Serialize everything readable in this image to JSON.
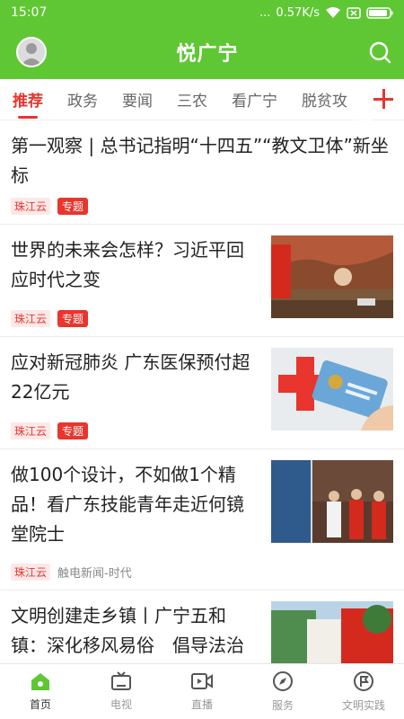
{
  "status": {
    "time": "15:07",
    "dots": "...",
    "speed": "0.57K/s"
  },
  "app": {
    "title": "悦广宁"
  },
  "tabs": [
    "推荐",
    "政务",
    "要闻",
    "三农",
    "看广宁",
    "脱贫攻"
  ],
  "articles": [
    {
      "title": "第一观察 | 总书记指明“十四五”“教文卫体”新坐标",
      "source": "珠江云",
      "tag": "专题"
    },
    {
      "title": "世界的未来会怎样？习近平回应时代之变",
      "source": "珠江云",
      "tag": "专题"
    },
    {
      "title": "应对新冠肺炎 广东医保预付超22亿元",
      "source": "珠江云",
      "tag": "专题"
    },
    {
      "title": "做100个设计，不如做1个精品！看广东技能青年走近何镜堂院士",
      "source": "珠江云",
      "meta": "触电新闻-时代"
    },
    {
      "title": "文明创建走乡镇丨广宁五和镇：深化移风易俗　倡导法治"
    }
  ],
  "nav": [
    {
      "label": "首页",
      "icon": "home-icon",
      "active": true
    },
    {
      "label": "电视",
      "icon": "tv-icon"
    },
    {
      "label": "直播",
      "icon": "live-icon"
    },
    {
      "label": "服务",
      "icon": "compass-icon"
    },
    {
      "label": "文明实践",
      "icon": "flag-icon"
    }
  ],
  "colors": {
    "brand": "#5fc734",
    "accent": "#e8352d"
  }
}
